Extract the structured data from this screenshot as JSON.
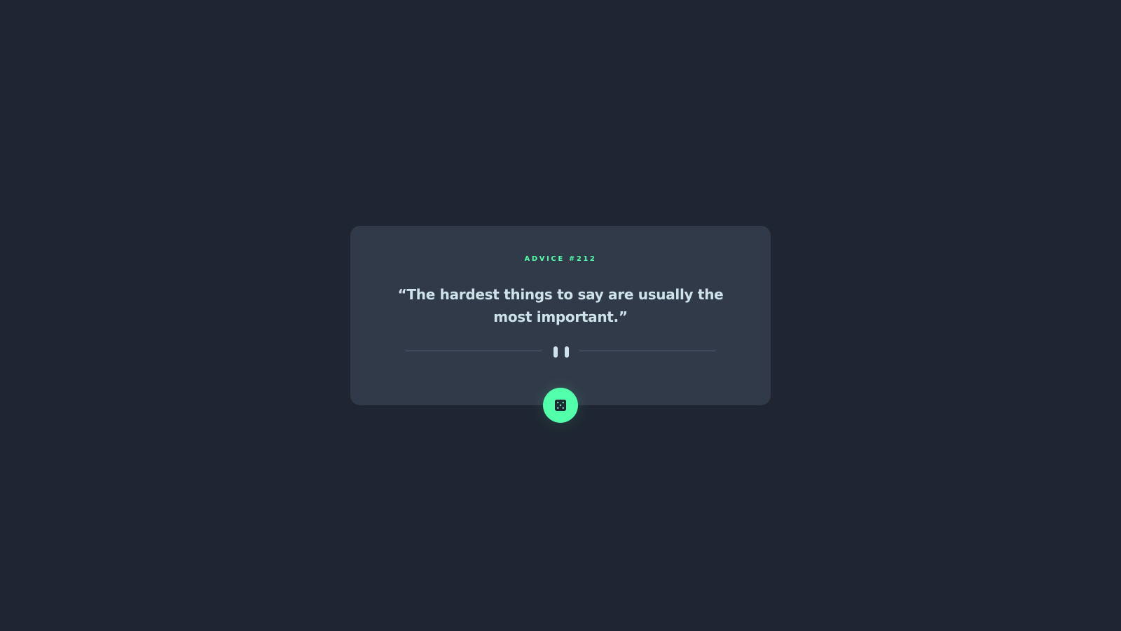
{
  "card": {
    "advice_label": "ADVICE #212",
    "quote": "“The hardest things to say are usually the most important.”"
  },
  "icons": {
    "divider": "pause-icon",
    "button": "dice-icon"
  },
  "colors": {
    "background": "#1f2632",
    "card": "#313a48",
    "accent": "#53ffaa",
    "text": "#cee3e9",
    "divider": "#4f5d74"
  }
}
